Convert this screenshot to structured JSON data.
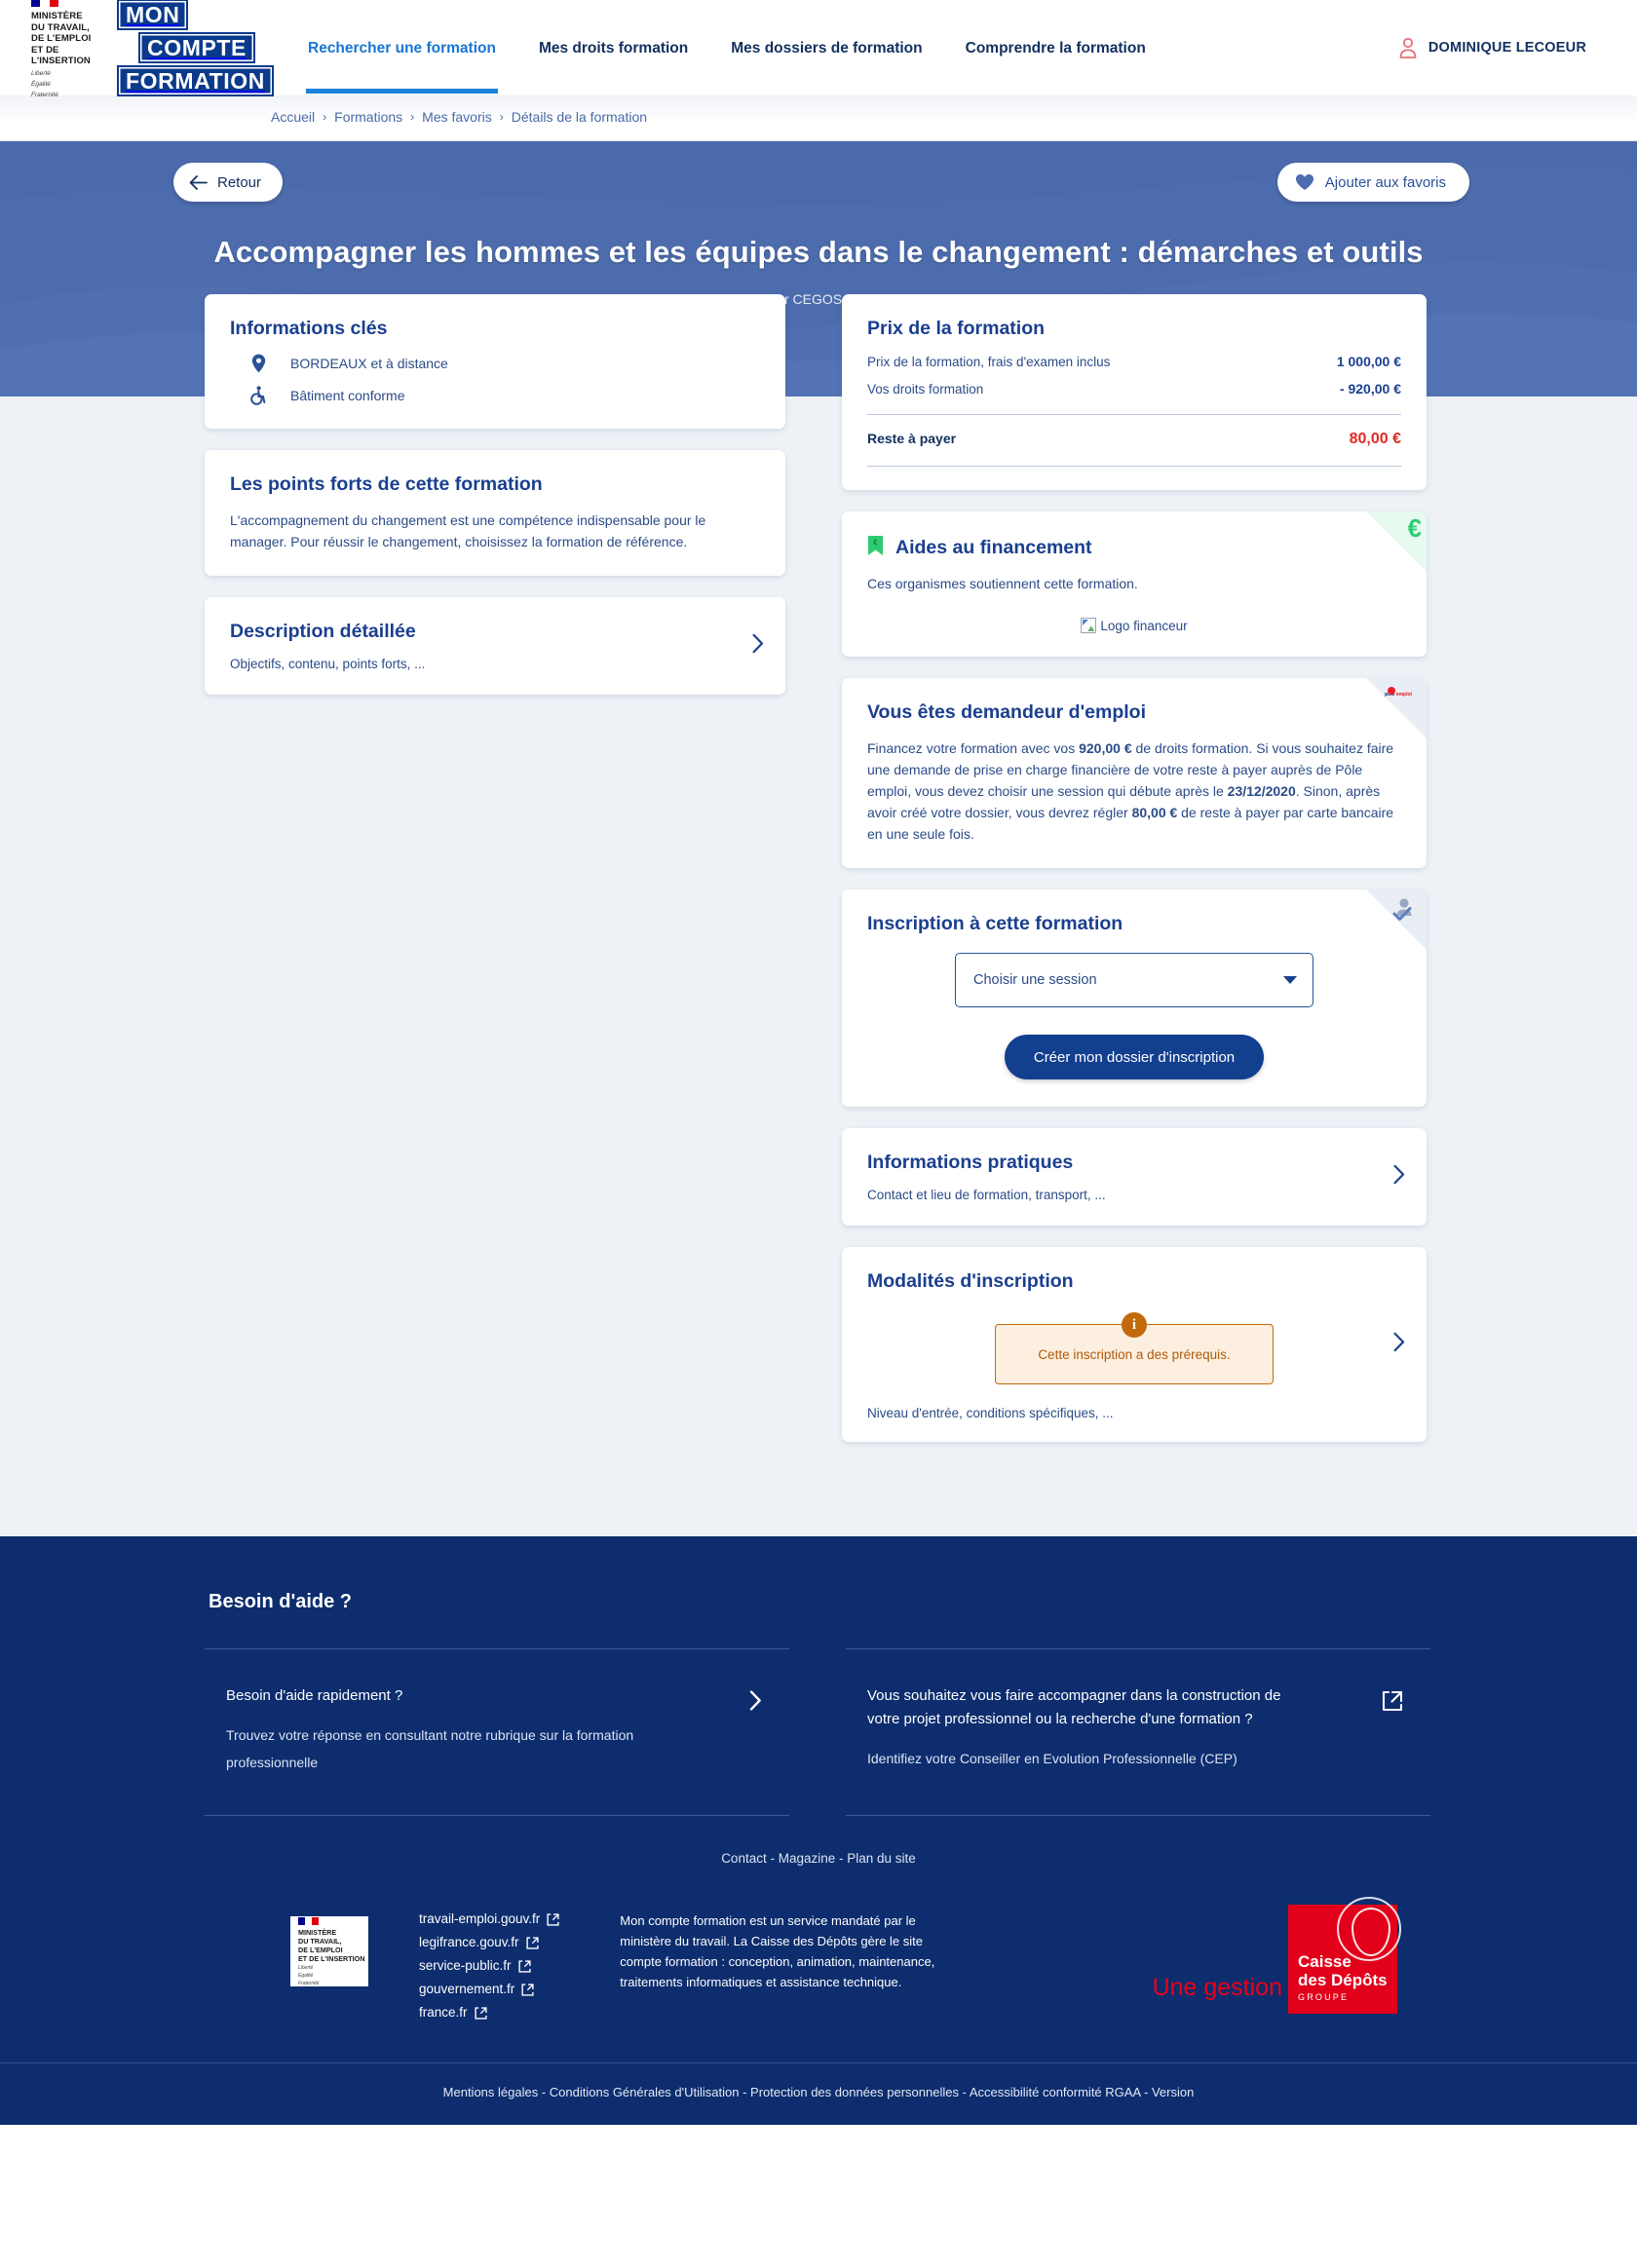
{
  "header": {
    "ministry_logo": {
      "lines": [
        "MINISTÈRE",
        "DU TRAVAIL,",
        "DE L'EMPLOI",
        "ET DE L'INSERTION"
      ],
      "devise": [
        "Liberté",
        "Égalité",
        "Fraternité"
      ]
    },
    "brand": {
      "line1": "MON",
      "line2": "COMPTE",
      "line3": "FORMATION"
    },
    "nav": [
      {
        "label": "Rechercher une formation",
        "active": true
      },
      {
        "label": "Mes droits formation",
        "active": false
      },
      {
        "label": "Mes dossiers de formation",
        "active": false
      },
      {
        "label": "Comprendre la formation",
        "active": false
      }
    ],
    "user_name": "DOMINIQUE LECOEUR"
  },
  "breadcrumb": {
    "items": [
      "Accueil",
      "Formations",
      "Mes favoris",
      "Détails de la formation"
    ],
    "separator": "›"
  },
  "hero": {
    "back_label": "Retour",
    "favorite_label": "Ajouter aux favoris",
    "title": "Accompagner les hommes et les équipes dans le changement : démarches et outils",
    "provider": "par CEGOS test"
  },
  "left_column": {
    "informations_cles": {
      "title": "Informations clés",
      "rows": [
        {
          "icon": "map-pin-icon",
          "text": "BORDEAUX et à distance"
        },
        {
          "icon": "accessibility-icon",
          "text": "Bâtiment conforme"
        }
      ]
    },
    "points_forts": {
      "title": "Les points forts de cette formation",
      "body": "L'accompagnement du changement est une compétence indispensable pour le manager. Pour réussir le changement, choisissez la formation de référence."
    },
    "description": {
      "title": "Description détaillée",
      "subtitle": "Objectifs, contenu, points forts, ..."
    }
  },
  "right_column": {
    "prix": {
      "title": "Prix de la formation",
      "lines": [
        {
          "label": "Prix de la formation, frais d'examen inclus",
          "value": "1 000,00 €"
        },
        {
          "label": "Vos droits formation",
          "value": "- 920,00 €"
        }
      ],
      "total_label": "Reste à payer",
      "total_value": "80,00 €"
    },
    "aides": {
      "title": "Aides au financement",
      "body": "Ces organismes soutiennent cette formation.",
      "logo_alt": "Logo financeur",
      "corner_glyph": "€"
    },
    "demandeur": {
      "title": "Vous êtes demandeur d'emploi",
      "text_parts": [
        {
          "t": "Financez votre formation avec vos ",
          "b": false
        },
        {
          "t": "920,00 €",
          "b": true
        },
        {
          "t": " de droits formation. Si vous souhaitez faire une demande de prise en charge financière de votre reste à payer auprès de Pôle emploi, vous devez choisir une session qui débute après le ",
          "b": false
        },
        {
          "t": "23/12/2020",
          "b": true
        },
        {
          "t": ". Sinon, après avoir créé votre dossier, vous devrez régler ",
          "b": false
        },
        {
          "t": "80,00 €",
          "b": true
        },
        {
          "t": " de reste à payer par carte bancaire en une seule fois.",
          "b": false
        }
      ],
      "badge": {
        "top": "pôle",
        "bottom": "emploi"
      }
    },
    "inscription": {
      "title": "Inscription à cette formation",
      "select_placeholder": "Choisir une session",
      "cta_label": "Créer mon dossier d'inscription"
    },
    "pratiques": {
      "title": "Informations pratiques",
      "subtitle": "Contact et lieu de formation, transport, ..."
    },
    "modalites": {
      "title": "Modalités d'inscription",
      "callout_badge": "i",
      "callout_text": "Cette inscription a des prérequis.",
      "subtitle": "Niveau d'entrée, conditions spécifiques, ..."
    }
  },
  "footer": {
    "help_title": "Besoin d'aide ?",
    "help_cards": [
      {
        "title": "Besoin d'aide rapidement ?",
        "desc": "Trouvez votre réponse en consultant notre rubrique sur la formation professionnelle",
        "action_icon": "chevron-right-icon"
      },
      {
        "title": "Vous souhaitez vous faire accompagner dans la construction de votre projet professionnel ou la recherche d'une formation ?",
        "desc": "Identifiez votre Conseiller en Evolution Professionnelle (CEP)",
        "action_icon": "external-link-icon"
      }
    ],
    "site_links": [
      "Contact",
      "Magazine",
      "Plan du site"
    ],
    "site_links_sep": " - ",
    "gov_links": [
      "travail-emploi.gouv.fr",
      "legifrance.gouv.fr",
      "service-public.fr",
      "gouvernement.fr",
      "france.fr"
    ],
    "mandate_text": "Mon compte formation est un service mandaté par le ministère du travail. La Caisse des Dépôts gère le site compte formation : conception, animation, maintenance, traitements informatiques et assistance technique.",
    "une_gestion": "Une gestion",
    "cdc": {
      "l1": "Caisse",
      "l2": "des Dépôts",
      "l3": "GROUPE"
    },
    "legal_links": [
      "Mentions légales",
      "Conditions Générales d'Utilisation",
      "Protection des données personnelles",
      "Accessibilité conformité RGAA",
      "Version"
    ],
    "legal_sep": " - "
  },
  "colors": {
    "brand_blue": "#0b3a8c",
    "hero_blue": "#4c6cad",
    "footer_blue": "#0d2d6e",
    "accent_red": "#e02a26",
    "accent_orange": "#c2690b",
    "accent_green": "#2ecc71",
    "link_blue": "#1976d2"
  }
}
